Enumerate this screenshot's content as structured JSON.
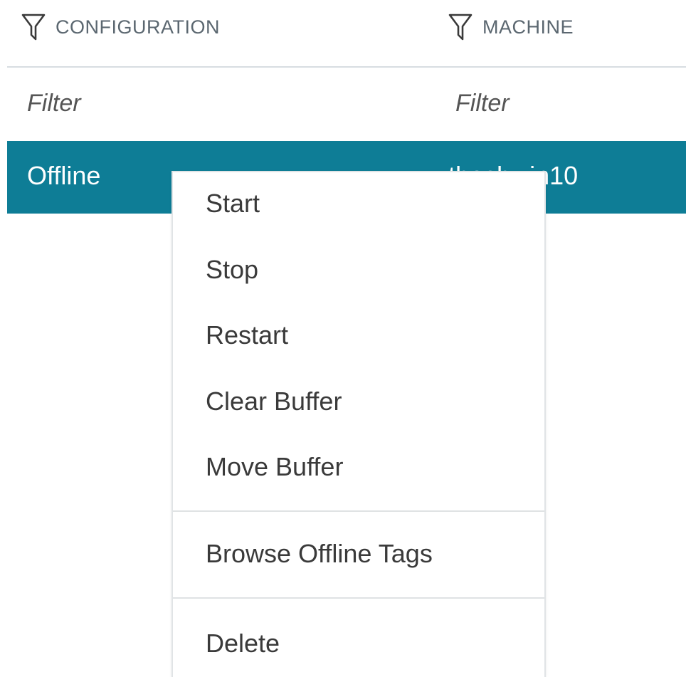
{
  "columns": {
    "configuration": {
      "label": "CONFIGURATION",
      "icon": "filter-funnel-icon"
    },
    "machine": {
      "label": "MACHINE",
      "icon": "filter-funnel-icon"
    }
  },
  "filters": {
    "configuration_placeholder": "Filter",
    "machine_placeholder": "Filter"
  },
  "row": {
    "configuration": "Offline",
    "machine": "thoshwin10",
    "selected_color": "#0e7d96"
  },
  "context_menu": {
    "items": [
      {
        "label": "Start"
      },
      {
        "label": "Stop"
      },
      {
        "label": "Restart"
      },
      {
        "label": "Clear Buffer"
      },
      {
        "label": "Move Buffer"
      },
      {
        "label": "Browse Offline Tags"
      },
      {
        "label": "Delete"
      }
    ]
  }
}
